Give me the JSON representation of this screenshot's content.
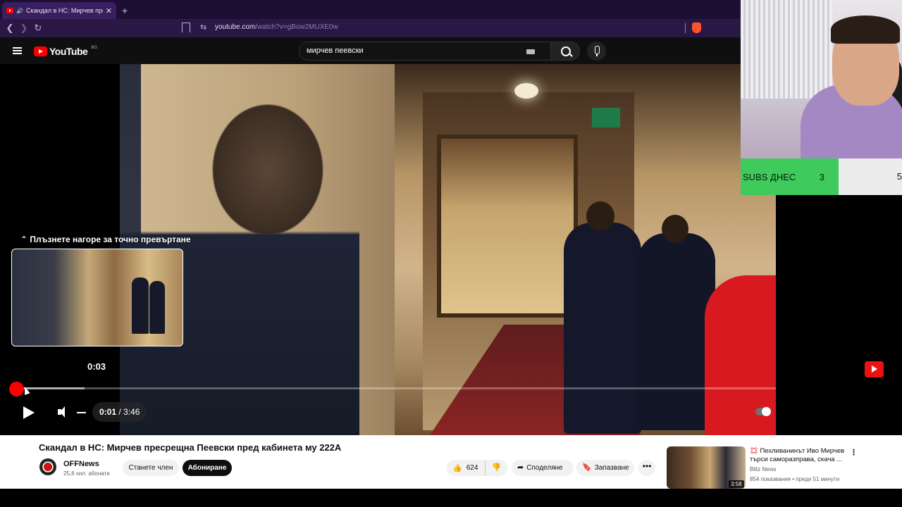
{
  "browser": {
    "tab_title": "Скандал в НС: Мирчев пресре",
    "tab_audio": "🔊",
    "tab_close": "✕",
    "new_tab": "+",
    "back": "❮",
    "forward": "❯",
    "reload": "↻",
    "site_info": "⇆",
    "url_host": "youtube.com",
    "url_path": "/watch?v=gBow2MUXE0w"
  },
  "youtube": {
    "logo_text": "YouTube",
    "region": "BG",
    "search_value": "мирчев пеевски"
  },
  "player": {
    "seek_hint": "⌃ Плъзнете нагоре за точно превъртане",
    "preview_time": "0:03",
    "current_time": "0:01",
    "separator": " / ",
    "duration": "3:46",
    "played_fraction": 0.001,
    "loaded_fraction": 0.078
  },
  "overlay": {
    "subs_label": "SUBS ДНЕС",
    "subs_value": "3",
    "subs_goal": "5"
  },
  "video": {
    "title": "Скандал в НС: Мирчев пресрещна Пеевски пред кабинета му 222А",
    "channel": "OFFNews",
    "subscribers": "25,8 хил. абонати",
    "member_button": "Станете член",
    "subscribe_button": "Абониране",
    "likes": "624",
    "share": "Споделяне",
    "save": "Запазване",
    "more": "•••"
  },
  "recommendation": {
    "title": "💢 Пехливанинът Иво Мирчев търси саморазправа, скача ...",
    "channel": "Blitz News",
    "meta": "854 показвания • преди 51 минути",
    "duration": "3:58",
    "menu": "⋮"
  }
}
